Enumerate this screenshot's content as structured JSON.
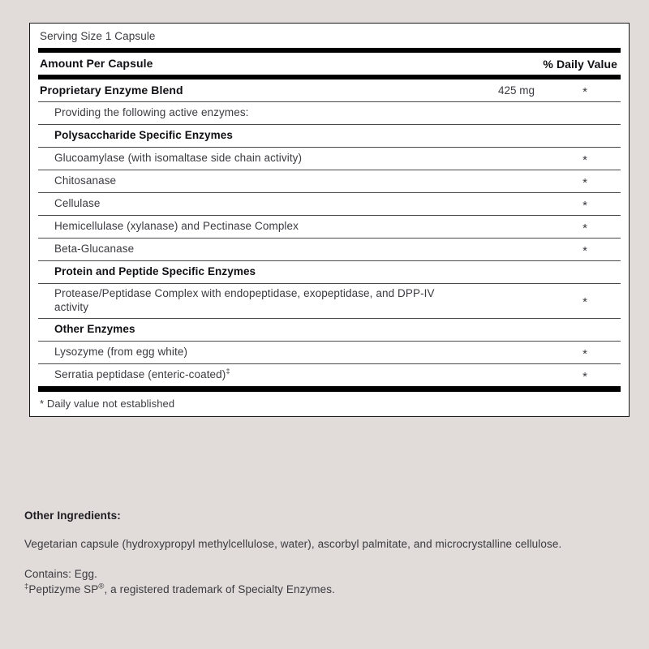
{
  "panel": {
    "serving_size": "Serving Size 1 Capsule",
    "header": {
      "amount_label": "Amount Per Capsule",
      "daily_value_label": "% Daily Value"
    },
    "footnote": "* Daily value not established",
    "star": "*"
  },
  "rows": [
    {
      "name": "Proprietary Enzyme Blend",
      "amount": "425 mg",
      "dv": "*",
      "style": "blend"
    },
    {
      "name": "Providing the following active enzymes:",
      "amount": "",
      "dv": "",
      "style": "note"
    },
    {
      "name": "Polysaccharide Specific Enzymes",
      "amount": "",
      "dv": "",
      "style": "group"
    },
    {
      "name": "Glucoamylase (with isomaltase side chain activity)",
      "amount": "",
      "dv": "*",
      "style": "item"
    },
    {
      "name": "Chitosanase",
      "amount": "",
      "dv": "*",
      "style": "item"
    },
    {
      "name": "Cellulase",
      "amount": "",
      "dv": "*",
      "style": "item"
    },
    {
      "name": "Hemicellulase (xylanase) and Pectinase Complex",
      "amount": "",
      "dv": "*",
      "style": "item"
    },
    {
      "name": "Beta-Glucanase",
      "amount": "",
      "dv": "*",
      "style": "item"
    },
    {
      "name": "Protein and Peptide Specific Enzymes",
      "amount": "",
      "dv": "",
      "style": "group"
    },
    {
      "name": "Protease/Peptidase Complex with endopeptidase, exopeptidase, and DPP-IV activity",
      "amount": "",
      "dv": "*",
      "style": "item"
    },
    {
      "name": "Other Enzymes",
      "amount": "",
      "dv": "",
      "style": "group"
    },
    {
      "name": "Lysozyme (from egg white)",
      "amount": "",
      "dv": "*",
      "style": "item"
    },
    {
      "name": "Serratia peptidase (enteric-coated)",
      "name_sup": "‡",
      "amount": "",
      "dv": "*",
      "style": "item"
    }
  ],
  "other_ingredients": {
    "title": "Other Ingredients:",
    "body": "Vegetarian capsule (hydroxypropyl methylcellulose, water), ascorbyl palmitate, and microcrystalline cellulose.",
    "contains": "Contains: Egg.",
    "trademark_prefix": "‡",
    "trademark_name": "Peptizyme SP",
    "trademark_sup": "®",
    "trademark_rest": ", a registered trademark of Specialty Enzymes."
  },
  "colors": {
    "page_background": "#e1dbd9",
    "panel_background": "#ffffff",
    "rule_heavy": "#000000",
    "text": "#3b3a40",
    "heading_text": "#101014"
  }
}
